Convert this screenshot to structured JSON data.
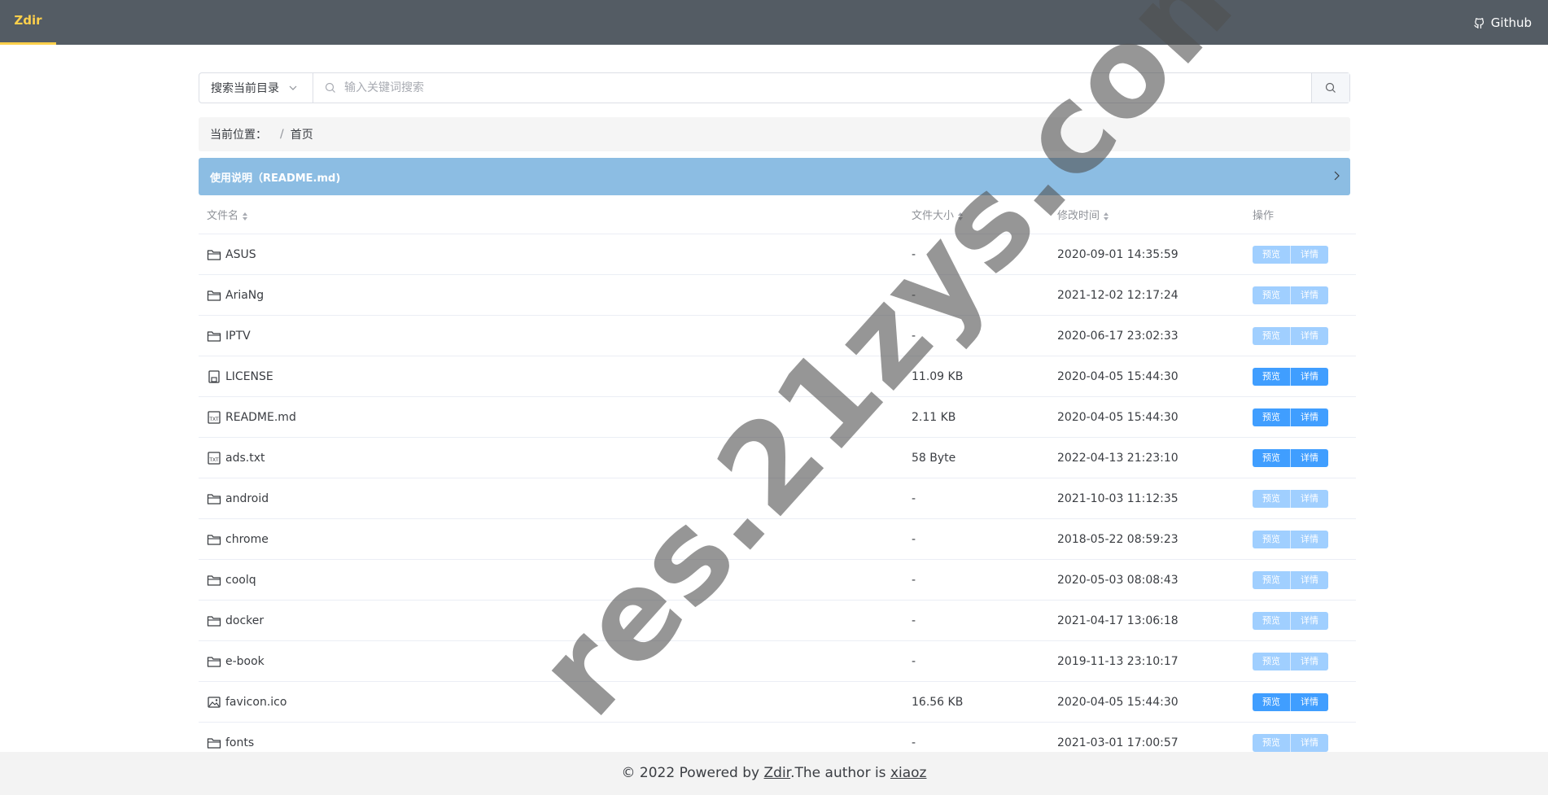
{
  "app": {
    "brand": "Zdir",
    "github_label": "Github"
  },
  "search": {
    "scope_label": "搜索当前目录",
    "placeholder": "输入关键词搜索"
  },
  "breadcrumb": {
    "label": "当前位置：",
    "separator": "/",
    "current": "首页"
  },
  "readme": {
    "label": "使用说明（README.md)"
  },
  "table": {
    "headers": {
      "name": "文件名",
      "size": "文件大小",
      "modified": "修改时间",
      "actions": "操作"
    },
    "preview_label": "预览",
    "detail_label": "详情",
    "rows": [
      {
        "name": "ASUS",
        "type": "folder",
        "size": "-",
        "modified": "2020-09-01 14:35:59",
        "enabled": false
      },
      {
        "name": "AriaNg",
        "type": "folder",
        "size": "-",
        "modified": "2021-12-02 12:17:24",
        "enabled": false
      },
      {
        "name": "IPTV",
        "type": "folder",
        "size": "-",
        "modified": "2020-06-17 23:02:33",
        "enabled": false
      },
      {
        "name": "LICENSE",
        "type": "file",
        "size": "11.09 KB",
        "modified": "2020-04-05 15:44:30",
        "enabled": true
      },
      {
        "name": "README.md",
        "type": "txt",
        "size": "2.11 KB",
        "modified": "2020-04-05 15:44:30",
        "enabled": true
      },
      {
        "name": "ads.txt",
        "type": "txt",
        "size": "58 Byte",
        "modified": "2022-04-13 21:23:10",
        "enabled": true
      },
      {
        "name": "android",
        "type": "folder",
        "size": "-",
        "modified": "2021-10-03 11:12:35",
        "enabled": false
      },
      {
        "name": "chrome",
        "type": "folder",
        "size": "-",
        "modified": "2018-05-22 08:59:23",
        "enabled": false
      },
      {
        "name": "coolq",
        "type": "folder",
        "size": "-",
        "modified": "2020-05-03 08:08:43",
        "enabled": false
      },
      {
        "name": "docker",
        "type": "folder",
        "size": "-",
        "modified": "2021-04-17 13:06:18",
        "enabled": false
      },
      {
        "name": "e-book",
        "type": "folder",
        "size": "-",
        "modified": "2019-11-13 23:10:17",
        "enabled": false
      },
      {
        "name": "favicon.ico",
        "type": "image",
        "size": "16.56 KB",
        "modified": "2020-04-05 15:44:30",
        "enabled": true
      },
      {
        "name": "fonts",
        "type": "folder",
        "size": "-",
        "modified": "2021-03-01 17:00:57",
        "enabled": false
      }
    ]
  },
  "footer": {
    "prefix": "© 2022 Powered by ",
    "powered_link": "Zdir",
    "middle": ".The author is ",
    "author_link": "xiaoz"
  },
  "watermark": {
    "text": "res.21zys.com"
  }
}
